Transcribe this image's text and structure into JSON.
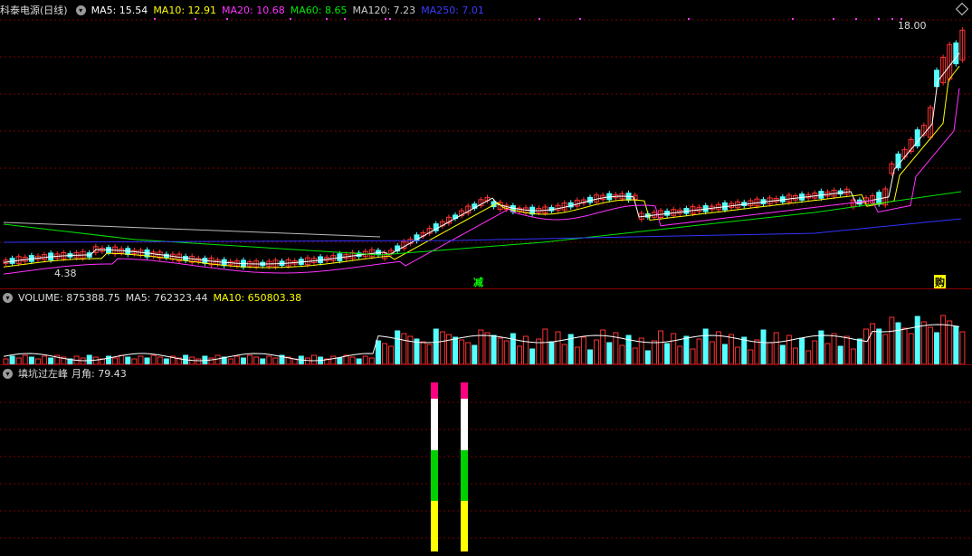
{
  "price_header": {
    "title": "科泰电源(日线)",
    "ma5": "MA5: 15.54",
    "ma10": "MA10: 12.91",
    "ma20": "MA20: 10.68",
    "ma60": "MA60: 8.65",
    "ma120": "MA120: 7.23",
    "ma250": "MA250: 7.01"
  },
  "price_annotations": {
    "high_label": "18.00",
    "low_label": "4.38",
    "signal_jian": "减",
    "signal_gou": "购"
  },
  "volume_header": {
    "title": "VOLUME: 875388.75",
    "ma5": "MA5: 762323.44",
    "ma10": "MA10: 650803.38"
  },
  "indicator_header": {
    "title": "填坑过左峰",
    "value": "月角: 79.43"
  },
  "colors": {
    "up": "#ff3232",
    "down": "#54ffff",
    "ma5": "#ffffff",
    "ma10": "#ffff00",
    "ma20": "#ff32ff",
    "ma60": "#00e600",
    "ma120": "#bbbbbb",
    "ma250": "#3232ff",
    "grid": "#7a0000"
  },
  "chart_data": {
    "type": "candlestick",
    "low": 4.38,
    "high": 18.0,
    "ma_last": {
      "MA5": 15.54,
      "MA10": 12.91,
      "MA20": 10.68,
      "MA60": 8.65,
      "MA120": 7.23,
      "MA250": 7.01
    },
    "volume_last": 875388.75,
    "volume_ma_last": {
      "MA5": 762323.44,
      "MA10": 650803.38
    },
    "indicator_value": 79.43
  }
}
